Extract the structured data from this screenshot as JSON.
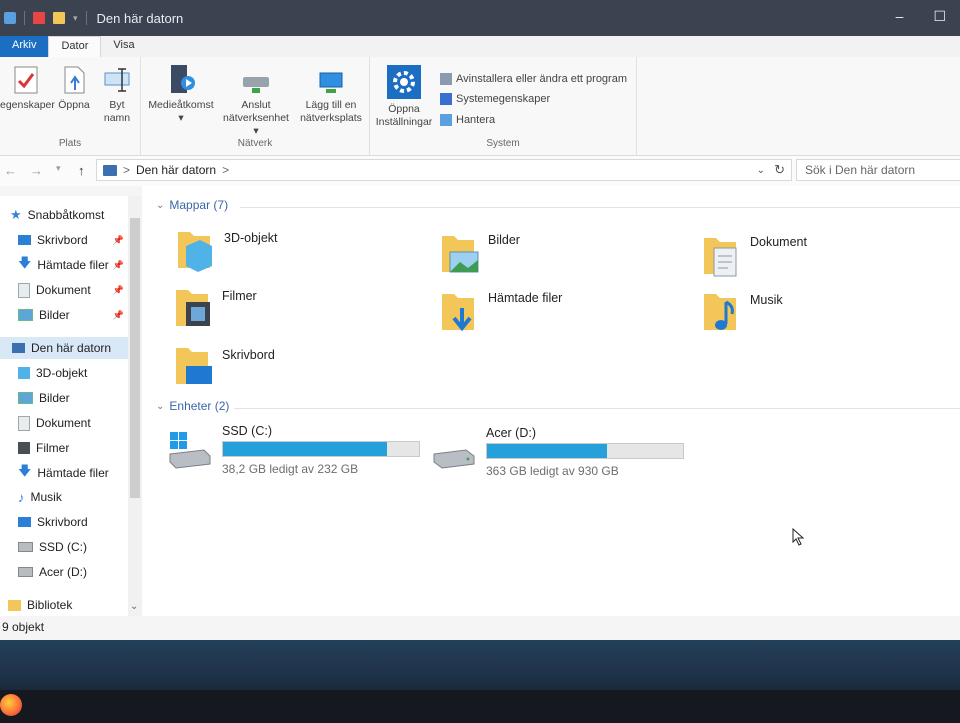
{
  "window": {
    "title": "Den här datorn",
    "controls": {
      "minimize": "–",
      "maximize": "☐"
    }
  },
  "ribbon": {
    "tabs": [
      "Arkiv",
      "Dator",
      "Visa"
    ],
    "groups": {
      "plats": {
        "label": "Plats",
        "buttons": [
          {
            "line1": "egenskaper",
            "line2": ""
          },
          {
            "line1": "Öppna",
            "line2": ""
          },
          {
            "line1": "Byt",
            "line2": "namn"
          }
        ]
      },
      "natverk": {
        "label": "Nätverk",
        "buttons": [
          {
            "line1": "Medieåtkomst",
            "line2": "▾"
          },
          {
            "line1": "Anslut",
            "line2": "nätverksenhet ▾"
          },
          {
            "line1": "Lägg till en",
            "line2": "nätverksplats"
          }
        ]
      },
      "system": {
        "label": "System",
        "open_settings": {
          "line1": "Öppna",
          "line2": "Inställningar"
        },
        "links": [
          "Avinstallera eller ändra ett program",
          "Systemegenskaper",
          "Hantera"
        ]
      }
    }
  },
  "addressbar": {
    "back": "←",
    "forward": "→",
    "up": "↑",
    "path": "Den här datorn",
    "separator": ">",
    "search_placeholder": "Sök i Den här datorn"
  },
  "sidebar": {
    "items": [
      {
        "label": "Snabbåtkomst",
        "pinned": false
      },
      {
        "label": "Skrivbord",
        "pinned": true
      },
      {
        "label": "Hämtade filer",
        "pinned": true
      },
      {
        "label": "Dokument",
        "pinned": true
      },
      {
        "label": "Bilder",
        "pinned": true
      },
      {
        "label": "Den här datorn",
        "pinned": false
      },
      {
        "label": "3D-objekt",
        "pinned": false
      },
      {
        "label": "Bilder",
        "pinned": false
      },
      {
        "label": "Dokument",
        "pinned": false
      },
      {
        "label": "Filmer",
        "pinned": false
      },
      {
        "label": "Hämtade filer",
        "pinned": false
      },
      {
        "label": "Musik",
        "pinned": false
      },
      {
        "label": "Skrivbord",
        "pinned": false
      },
      {
        "label": "SSD (C:)",
        "pinned": false
      },
      {
        "label": "Acer (D:)",
        "pinned": false
      },
      {
        "label": "Bibliotek",
        "pinned": false
      }
    ]
  },
  "main": {
    "folders_header": "Mappar (7)",
    "folders": [
      "3D-objekt",
      "Bilder",
      "Dokument",
      "Filmer",
      "Hämtade filer",
      "Musik",
      "Skrivbord"
    ],
    "drives_header": "Enheter (2)",
    "drives": [
      {
        "name": "SSD (C:)",
        "free_text": "38,2 GB ledigt av 232 GB",
        "used_fraction": 0.835
      },
      {
        "name": "Acer (D:)",
        "free_text": "363 GB ledigt av 930 GB",
        "used_fraction": 0.61
      }
    ]
  },
  "status": {
    "count": "9 objekt"
  },
  "colors": {
    "accent": "#1b6ec2",
    "drive_bar": "#26a0da",
    "folder": "#f3c65a"
  }
}
